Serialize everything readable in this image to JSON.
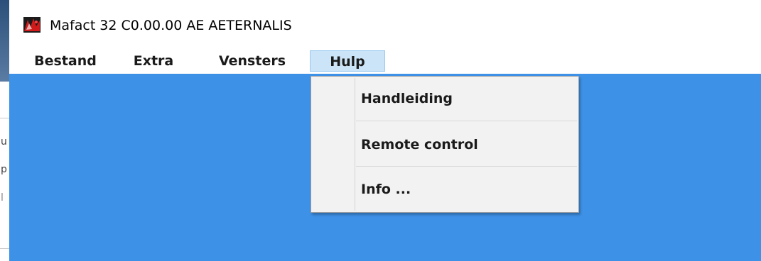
{
  "window": {
    "title": "Mafact 32 C0.00.00  AE AETERNALIS",
    "icon": "mafact-app-icon"
  },
  "menu_bar": {
    "items": [
      {
        "label": "Bestand"
      },
      {
        "label": "Extra"
      },
      {
        "label": "Vensters"
      },
      {
        "label": "Hulp",
        "active": true
      }
    ]
  },
  "help_menu": {
    "items": [
      {
        "label": "Handleiding"
      },
      {
        "label": "Remote control"
      },
      {
        "label": "Info ..."
      }
    ]
  },
  "background_window": {
    "glyphs": [
      "u",
      "p",
      "l"
    ]
  },
  "colors": {
    "workspace": "#3d91e6",
    "menu_active_bg": "#cce4f7",
    "menu_active_border": "#99c9ef",
    "dropdown_bg": "#f2f2f2"
  }
}
